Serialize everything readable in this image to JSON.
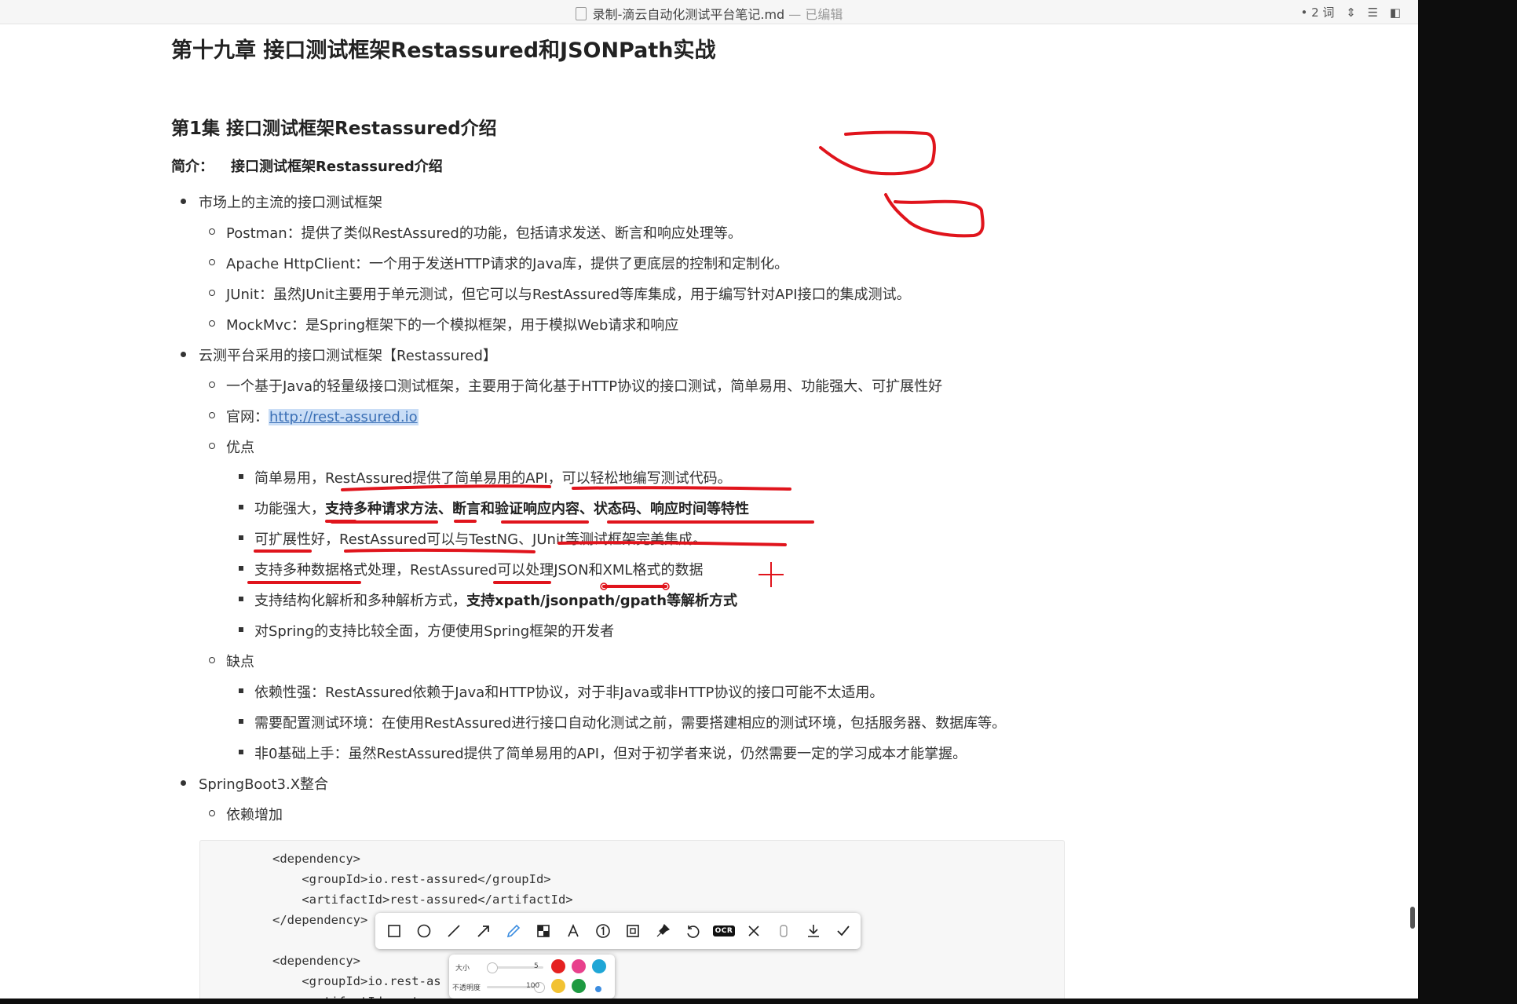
{
  "window": {
    "title": "录制-滴云自动化测试平台笔记.md",
    "edited": "— 已编辑",
    "word_count": "• 2 词"
  },
  "doc": {
    "h1": "第十九章 接口测试框架Restassured和JSONPath实战",
    "h2": "第1集 接口测试框架Restassured介绍",
    "intro_label": "简介：",
    "intro_text": "接口测试框架Restassured介绍",
    "s1": "市场上的主流的接口测试框架",
    "s1_items": [
      "Postman：提供了类似RestAssured的功能，包括请求发送、断言和响应处理等。",
      "Apache HttpClient：一个用于发送HTTP请求的Java库，提供了更底层的控制和定制化。",
      "JUnit：虽然JUnit主要用于单元测试，但它可以与RestAssured等库集成，用于编写针对API接口的集成测试。",
      "MockMvc：是Spring框架下的一个模拟框架，用于模拟Web请求和响应"
    ],
    "s2": "云测平台采用的接口测试框架【Restassured】",
    "s2_desc": "一个基于Java的轻量级接口测试框架，主要用于简化基于HTTP协议的接口测试，简单易用、功能强大、可扩展性好",
    "site_label": "官网：",
    "site_url": "http://rest-assured.io",
    "pros_label": "优点",
    "pros": {
      "p1": "简单易用，RestAssured提供了简单易用的API，可以轻松地编写测试代码。",
      "p2_a": "功能强大，",
      "p2_b": "支持多种请求方法、断言和验证响应内容、状态码、响应时间等特性",
      "p3": "可扩展性好，RestAssured可以与TestNG、JUnit等测试框架完美集成。",
      "p4": "支持多种数据格式处理，RestAssured可以处理JSON和XML格式的数据",
      "p5_a": "支持结构化解析和多种解析方式，",
      "p5_b": "支持xpath/jsonpath/gpath",
      "p5_c": "等解析方式",
      "p6": "对Spring的支持比较全面，方便使用Spring框架的开发者"
    },
    "cons_label": "缺点",
    "cons": [
      "依赖性强：RestAssured依赖于Java和HTTP协议，对于非Java或非HTTP协议的接口可能不太适用。",
      "需要配置测试环境：在使用RestAssured进行接口自动化测试之前，需要搭建相应的测试环境，包括服务器、数据库等。",
      "非0基础上手：虽然RestAssured提供了简单易用的API，但对于初学者来说，仍然需要一定的学习成本才能掌握。"
    ],
    "s3": "SpringBoot3.X整合",
    "s3_item": "依赖增加",
    "code": "<dependency>\n    <groupId>io.rest-assured</groupId>\n    <artifactId>rest-assured</artifactId>\n</dependency>\n\n<dependency>\n    <groupId>io.rest-as\n    <artifactId>rest-assured-all</artifactId>"
  },
  "annotation_toolbar": {
    "tools": [
      "rectangle-icon",
      "ellipse-icon",
      "line-icon",
      "arrow-icon",
      "pen-icon",
      "mosaic-icon",
      "text-icon",
      "number-icon",
      "frame-icon",
      "pin-icon",
      "undo-icon",
      "ocr-icon",
      "close-icon",
      "save-icon",
      "download-icon",
      "confirm-icon"
    ],
    "ocr_label": "OCR",
    "size_label": "大小",
    "size_value": "5",
    "opacity_label": "不透明度",
    "opacity_value": "100",
    "colors": [
      "#e52121",
      "#e8408c",
      "#1fa6d6",
      "#f2c232",
      "#1e9a41",
      "#3c8de0"
    ]
  }
}
